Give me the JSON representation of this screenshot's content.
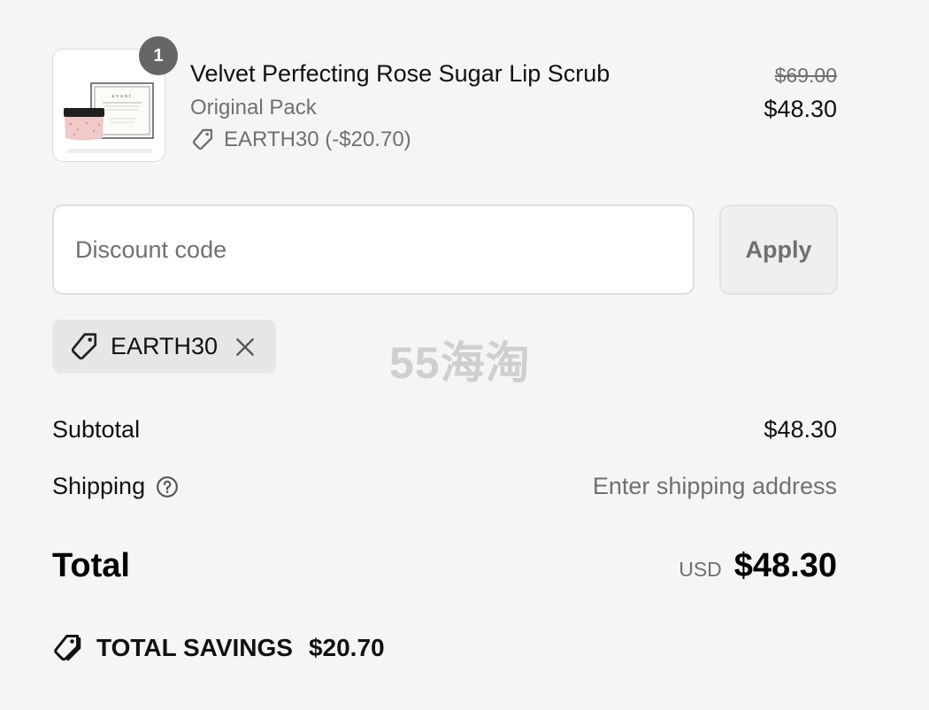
{
  "line_item": {
    "quantity": "1",
    "name": "Velvet Perfecting Rose Sugar Lip Scrub",
    "variant": "Original Pack",
    "discount_text": "EARTH30 (-$20.70)",
    "original_price": "$69.00",
    "price": "$48.30",
    "image_icon": "product-image",
    "image_brand_text": "avant"
  },
  "discount": {
    "placeholder": "Discount code",
    "value": "",
    "apply_label": "Apply",
    "applied_code": "EARTH30"
  },
  "watermark": "55海淘",
  "summary": {
    "subtotal_label": "Subtotal",
    "subtotal_value": "$48.30",
    "shipping_label": "Shipping",
    "shipping_value": "Enter shipping address",
    "total_label": "Total",
    "currency": "USD",
    "total_value": "$48.30",
    "savings_label": "TOTAL SAVINGS",
    "savings_value": "$20.70"
  },
  "colors": {
    "background": "#f5f5f5",
    "muted_text": "#707070",
    "badge": "#666666",
    "chip": "#e6e6e6"
  }
}
